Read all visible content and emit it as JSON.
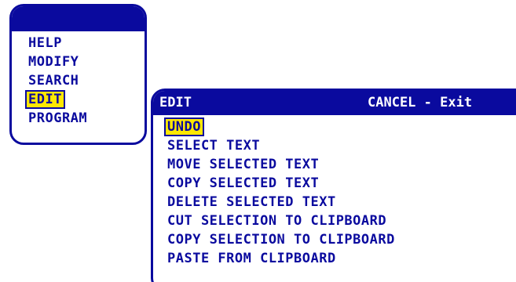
{
  "main_menu": {
    "items": [
      {
        "label": "HELP",
        "selected": false
      },
      {
        "label": "MODIFY",
        "selected": false
      },
      {
        "label": "SEARCH",
        "selected": false
      },
      {
        "label": "EDIT",
        "selected": true
      },
      {
        "label": "PROGRAM",
        "selected": false
      }
    ]
  },
  "edit_menu": {
    "title": "EDIT",
    "cancel_hint": "CANCEL - Exit",
    "items": [
      {
        "label": "UNDO",
        "selected": true
      },
      {
        "label": "SELECT TEXT",
        "selected": false
      },
      {
        "label": "MOVE SELECTED TEXT",
        "selected": false
      },
      {
        "label": "COPY SELECTED TEXT",
        "selected": false
      },
      {
        "label": "DELETE SELECTED TEXT",
        "selected": false
      },
      {
        "label": "CUT SELECTION TO CLIPBOARD",
        "selected": false
      },
      {
        "label": "COPY SELECTION TO CLIPBOARD",
        "selected": false
      },
      {
        "label": "PASTE FROM CLIPBOARD",
        "selected": false
      }
    ]
  },
  "colors": {
    "menu_blue": "#0a0a9e",
    "highlight_yellow": "#ffe800",
    "background": "#ffffff"
  }
}
